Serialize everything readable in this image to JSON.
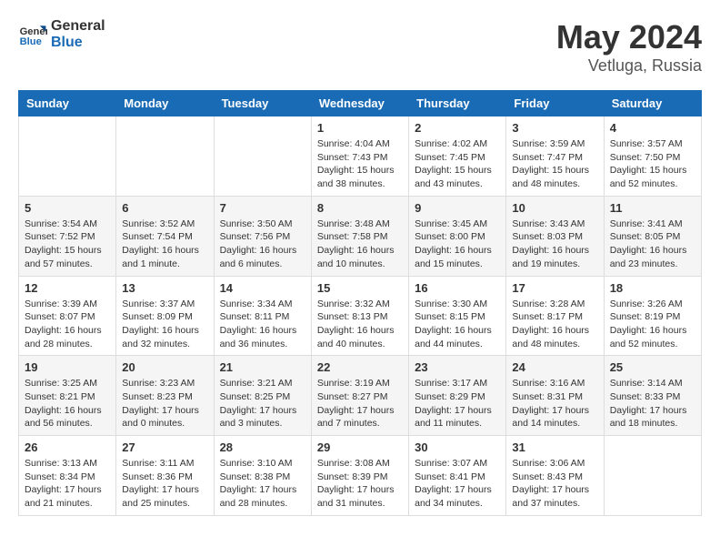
{
  "header": {
    "logo_general": "General",
    "logo_blue": "Blue",
    "month_title": "May 2024",
    "location": "Vetluga, Russia"
  },
  "weekdays": [
    "Sunday",
    "Monday",
    "Tuesday",
    "Wednesday",
    "Thursday",
    "Friday",
    "Saturday"
  ],
  "weeks": [
    [
      {
        "day": null,
        "info": null
      },
      {
        "day": null,
        "info": null
      },
      {
        "day": null,
        "info": null
      },
      {
        "day": "1",
        "info": "Sunrise: 4:04 AM\nSunset: 7:43 PM\nDaylight: 15 hours\nand 38 minutes."
      },
      {
        "day": "2",
        "info": "Sunrise: 4:02 AM\nSunset: 7:45 PM\nDaylight: 15 hours\nand 43 minutes."
      },
      {
        "day": "3",
        "info": "Sunrise: 3:59 AM\nSunset: 7:47 PM\nDaylight: 15 hours\nand 48 minutes."
      },
      {
        "day": "4",
        "info": "Sunrise: 3:57 AM\nSunset: 7:50 PM\nDaylight: 15 hours\nand 52 minutes."
      }
    ],
    [
      {
        "day": "5",
        "info": "Sunrise: 3:54 AM\nSunset: 7:52 PM\nDaylight: 15 hours\nand 57 minutes."
      },
      {
        "day": "6",
        "info": "Sunrise: 3:52 AM\nSunset: 7:54 PM\nDaylight: 16 hours\nand 1 minute."
      },
      {
        "day": "7",
        "info": "Sunrise: 3:50 AM\nSunset: 7:56 PM\nDaylight: 16 hours\nand 6 minutes."
      },
      {
        "day": "8",
        "info": "Sunrise: 3:48 AM\nSunset: 7:58 PM\nDaylight: 16 hours\nand 10 minutes."
      },
      {
        "day": "9",
        "info": "Sunrise: 3:45 AM\nSunset: 8:00 PM\nDaylight: 16 hours\nand 15 minutes."
      },
      {
        "day": "10",
        "info": "Sunrise: 3:43 AM\nSunset: 8:03 PM\nDaylight: 16 hours\nand 19 minutes."
      },
      {
        "day": "11",
        "info": "Sunrise: 3:41 AM\nSunset: 8:05 PM\nDaylight: 16 hours\nand 23 minutes."
      }
    ],
    [
      {
        "day": "12",
        "info": "Sunrise: 3:39 AM\nSunset: 8:07 PM\nDaylight: 16 hours\nand 28 minutes."
      },
      {
        "day": "13",
        "info": "Sunrise: 3:37 AM\nSunset: 8:09 PM\nDaylight: 16 hours\nand 32 minutes."
      },
      {
        "day": "14",
        "info": "Sunrise: 3:34 AM\nSunset: 8:11 PM\nDaylight: 16 hours\nand 36 minutes."
      },
      {
        "day": "15",
        "info": "Sunrise: 3:32 AM\nSunset: 8:13 PM\nDaylight: 16 hours\nand 40 minutes."
      },
      {
        "day": "16",
        "info": "Sunrise: 3:30 AM\nSunset: 8:15 PM\nDaylight: 16 hours\nand 44 minutes."
      },
      {
        "day": "17",
        "info": "Sunrise: 3:28 AM\nSunset: 8:17 PM\nDaylight: 16 hours\nand 48 minutes."
      },
      {
        "day": "18",
        "info": "Sunrise: 3:26 AM\nSunset: 8:19 PM\nDaylight: 16 hours\nand 52 minutes."
      }
    ],
    [
      {
        "day": "19",
        "info": "Sunrise: 3:25 AM\nSunset: 8:21 PM\nDaylight: 16 hours\nand 56 minutes."
      },
      {
        "day": "20",
        "info": "Sunrise: 3:23 AM\nSunset: 8:23 PM\nDaylight: 17 hours\nand 0 minutes."
      },
      {
        "day": "21",
        "info": "Sunrise: 3:21 AM\nSunset: 8:25 PM\nDaylight: 17 hours\nand 3 minutes."
      },
      {
        "day": "22",
        "info": "Sunrise: 3:19 AM\nSunset: 8:27 PM\nDaylight: 17 hours\nand 7 minutes."
      },
      {
        "day": "23",
        "info": "Sunrise: 3:17 AM\nSunset: 8:29 PM\nDaylight: 17 hours\nand 11 minutes."
      },
      {
        "day": "24",
        "info": "Sunrise: 3:16 AM\nSunset: 8:31 PM\nDaylight: 17 hours\nand 14 minutes."
      },
      {
        "day": "25",
        "info": "Sunrise: 3:14 AM\nSunset: 8:33 PM\nDaylight: 17 hours\nand 18 minutes."
      }
    ],
    [
      {
        "day": "26",
        "info": "Sunrise: 3:13 AM\nSunset: 8:34 PM\nDaylight: 17 hours\nand 21 minutes."
      },
      {
        "day": "27",
        "info": "Sunrise: 3:11 AM\nSunset: 8:36 PM\nDaylight: 17 hours\nand 25 minutes."
      },
      {
        "day": "28",
        "info": "Sunrise: 3:10 AM\nSunset: 8:38 PM\nDaylight: 17 hours\nand 28 minutes."
      },
      {
        "day": "29",
        "info": "Sunrise: 3:08 AM\nSunset: 8:39 PM\nDaylight: 17 hours\nand 31 minutes."
      },
      {
        "day": "30",
        "info": "Sunrise: 3:07 AM\nSunset: 8:41 PM\nDaylight: 17 hours\nand 34 minutes."
      },
      {
        "day": "31",
        "info": "Sunrise: 3:06 AM\nSunset: 8:43 PM\nDaylight: 17 hours\nand 37 minutes."
      },
      {
        "day": null,
        "info": null
      }
    ]
  ]
}
